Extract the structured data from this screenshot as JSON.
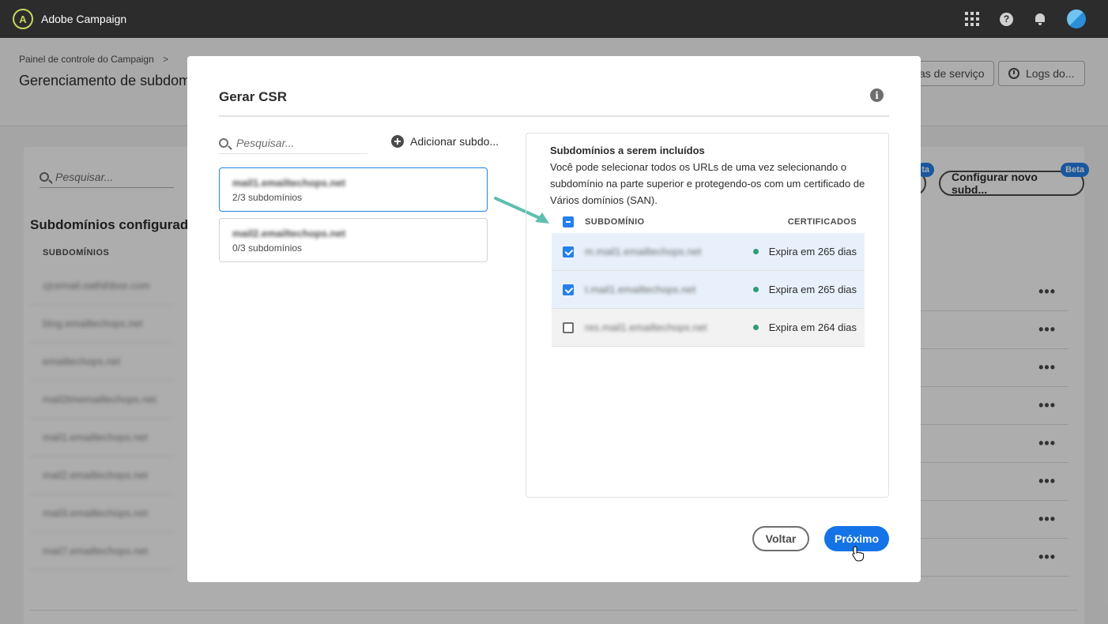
{
  "app": {
    "title": "Adobe Campaign",
    "logo_glyph": "A"
  },
  "topbar": {
    "icons": [
      "apps-grid-icon",
      "help-icon",
      "bell-icon",
      "avatar"
    ]
  },
  "background": {
    "breadcrumb": "Painel de controle do Campaign",
    "breadcrumb_sep": ">",
    "page_title": "Gerenciamento de subdomín",
    "btn_service": "as de serviço",
    "btn_logs": "Logs do...",
    "search_placeholder": "Pesquisar...",
    "section_title": "Subdomínios configurados",
    "col_header": "SUBDOMÍNIOS",
    "rows": [
      "cjcemail.oaththbxe.com",
      "blog.emailtechops.net",
      "emailtechops.net",
      "mail2tmemailtechops.net",
      "mail1.emailtechops.net",
      "mail2.emailtechops.net",
      "mail3.emailtechops.net",
      "mail7.emailtechops.net"
    ],
    "row_menu": "•••",
    "btn_beta_partial": "",
    "btn_configure": "Configurar novo subd...",
    "beta_label": "Beta",
    "beta_label_partial": "ta"
  },
  "modal": {
    "title": "Gerar CSR",
    "search_placeholder": "Pesquisar...",
    "add_label": "Adicionar subdo...",
    "domains": [
      {
        "name": "mail1.emailtechops.net",
        "count": "2/3 subdomínios",
        "selected": true
      },
      {
        "name": "mail2.emailtechops.net",
        "count": "0/3 subdomínios",
        "selected": false
      }
    ],
    "panel": {
      "title": "Subdomínios a serem incluídos",
      "description": "Você pode selecionar todos os URLs de uma vez selecionando o subdomínio na parte superior e protegendo-os com um certificado de Vários domínios (SAN).",
      "col_subdomain": "SUBDOMÍNIO",
      "col_certs": "CERTIFICADOS",
      "rows": [
        {
          "domain": "m.mail1.emailtechops.net",
          "cert": "Expira em 265 dias",
          "checked": true
        },
        {
          "domain": "t.mail1.emailtechops.net",
          "cert": "Expira em 265 dias",
          "checked": true
        },
        {
          "domain": "res.mail1.emailtechops.net",
          "cert": "Expira em 264 dias",
          "checked": false
        }
      ]
    },
    "btn_back": "Voltar",
    "btn_next": "Próximo"
  },
  "colors": {
    "accent": "#1473e6",
    "status_ok": "#2d9d78",
    "arrow": "#5fbfae"
  }
}
